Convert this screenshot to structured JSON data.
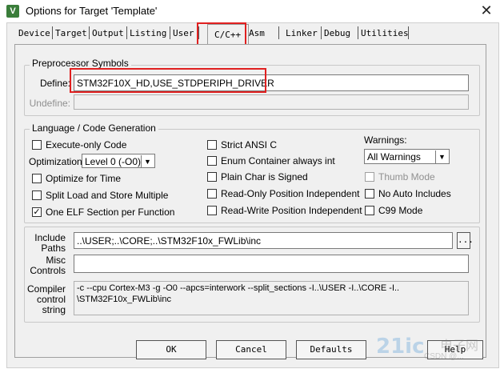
{
  "window": {
    "title": "Options for Target 'Template'",
    "icon": "keil-uvision-icon",
    "close_glyph": "✕",
    "icon_letter": "V"
  },
  "tabs": [
    "Device",
    "Target",
    "Output",
    "Listing",
    "User",
    "C/C++",
    "Asm",
    "Linker",
    "Debug",
    "Utilities"
  ],
  "active_tab": "C/C++",
  "preprocessor": {
    "legend": "Preprocessor Symbols",
    "define_label": "Define:",
    "define_value": "STM32F10X_HD,USE_STDPERIPH_DRIVER",
    "undefine_label": "Undefine:",
    "undefine_value": ""
  },
  "language": {
    "legend": "Language / Code Generation",
    "execute_only": {
      "label": "Execute-only Code",
      "checked": false
    },
    "optimization_label": "Optimization:",
    "optimization_value": "Level 0 (-O0)",
    "optimize_time": {
      "label": "Optimize for Time",
      "checked": false
    },
    "split_load": {
      "label": "Split Load and Store Multiple",
      "checked": false
    },
    "one_elf": {
      "label": "One ELF Section per Function",
      "checked": true
    },
    "strict_ansi": {
      "label": "Strict ANSI C",
      "checked": false
    },
    "enum_container": {
      "label": "Enum Container always int",
      "checked": false
    },
    "plain_char": {
      "label": "Plain Char is Signed",
      "checked": false
    },
    "ro_pi": {
      "label": "Read-Only Position Independent",
      "checked": false
    },
    "rw_pi": {
      "label": "Read-Write Position Independent",
      "checked": false
    },
    "warnings_label": "Warnings:",
    "warnings_value": "All Warnings",
    "thumb_mode": {
      "label": "Thumb Mode",
      "checked": false,
      "disabled": true
    },
    "no_auto_includes": {
      "label": "No Auto Includes",
      "checked": false
    },
    "c99_mode": {
      "label": "C99 Mode",
      "checked": false
    }
  },
  "paths": {
    "include_label_1": "Include",
    "include_label_2": "Paths",
    "include_value": "..\\USER;..\\CORE;..\\STM32F10x_FWLib\\inc",
    "browse_label": "...",
    "misc_label_1": "Misc",
    "misc_label_2": "Controls",
    "misc_value": "",
    "compiler_label_1": "Compiler",
    "compiler_label_2": "control",
    "compiler_label_3": "string",
    "compiler_line_1": "-c --cpu Cortex-M3 -g -O0 --apcs=interwork --split_sections -I..\\USER -I..\\CORE -I..",
    "compiler_line_2": "\\STM32F10x_FWLib\\inc"
  },
  "buttons": {
    "ok": "OK",
    "cancel": "Cancel",
    "defaults": "Defaults",
    "help": "Help"
  },
  "watermark": {
    "text_1": "电子网",
    "text_2": "CSDN @...",
    "logo": "21ic"
  },
  "colors": {
    "highlight_red": "#e02020",
    "dialog_bg": "#f0f0f0"
  }
}
